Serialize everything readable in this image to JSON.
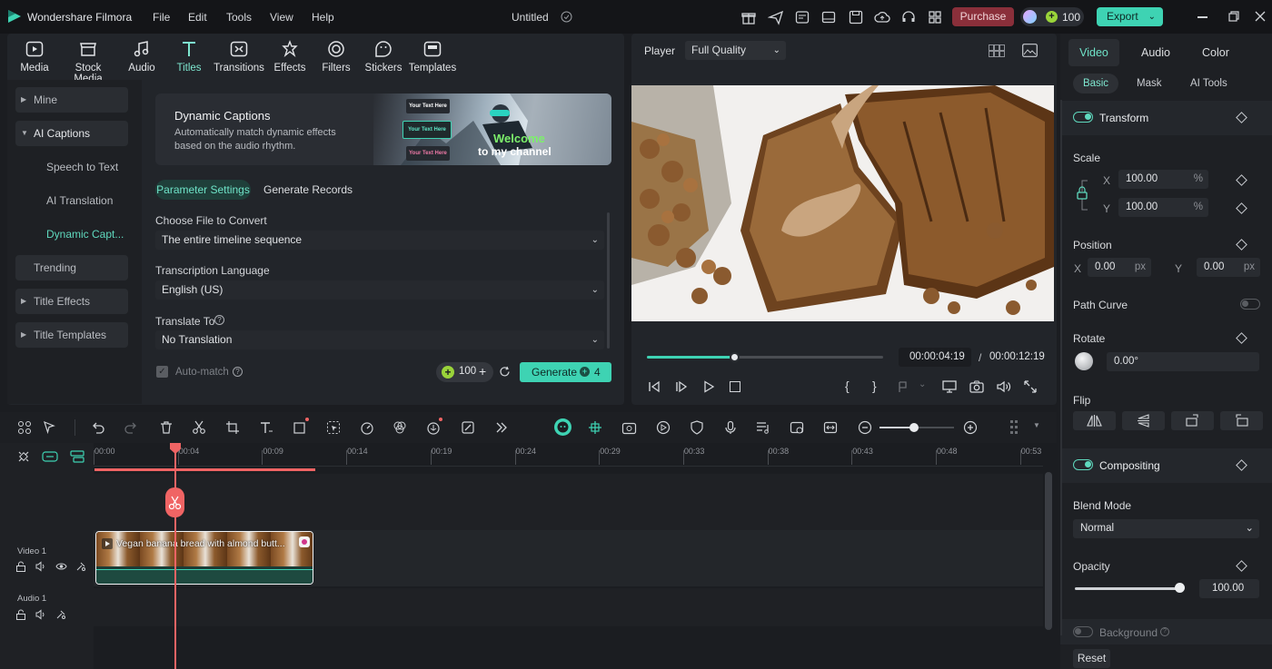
{
  "app": {
    "name": "Wondershare Filmora",
    "project_title": "Untitled"
  },
  "menu": [
    "File",
    "Edit",
    "Tools",
    "View",
    "Help"
  ],
  "topbar": {
    "purchase": "Purchase",
    "credits": "100",
    "export": "Export"
  },
  "library_tabs": [
    "Media",
    "Stock Media",
    "Audio",
    "Titles",
    "Transitions",
    "Effects",
    "Filters",
    "Stickers",
    "Templates"
  ],
  "active_library_tab": "Titles",
  "sidebar": {
    "mine": "Mine",
    "ai_captions": "AI Captions",
    "speech_to_text": "Speech to Text",
    "ai_translation": "AI Translation",
    "dynamic_captions": "Dynamic Capt...",
    "trending": "Trending",
    "title_effects": "Title Effects",
    "title_templates": "Title Templates"
  },
  "banner": {
    "title": "Dynamic Captions",
    "desc": "Automatically match dynamic effects based on the audio rhythm.",
    "card1": "Your Text Here",
    "card2": "Your Text Here",
    "card3": "Your Text Here",
    "overlay1": "Welcome",
    "overlay2": "to my channel"
  },
  "subtabs": {
    "param": "Parameter Settings",
    "records": "Generate Records"
  },
  "form": {
    "file_label": "Choose File to Convert",
    "file_value": "The entire timeline sequence",
    "lang_label": "Transcription Language",
    "lang_value": "English (US)",
    "translate_label": "Translate To",
    "translate_value": "No Translation",
    "automatch": "Auto-match",
    "credits": "100",
    "generate": "Generate",
    "generate_cost": "4"
  },
  "player": {
    "label": "Player",
    "quality": "Full Quality",
    "current_time": "00:00:04:19",
    "sep": "/",
    "total_time": "00:00:12:19",
    "progress": 0.37
  },
  "props": {
    "tabs": [
      "Video",
      "Audio",
      "Color"
    ],
    "subtabs": [
      "Basic",
      "Mask",
      "AI Tools"
    ],
    "transform": "Transform",
    "scale": "Scale",
    "x": "X",
    "y": "Y",
    "scale_x": "100.00",
    "scale_y": "100.00",
    "pct": "%",
    "position": "Position",
    "pos_x": "0.00",
    "pos_y": "0.00",
    "px": "px",
    "path_curve": "Path Curve",
    "rotate": "Rotate",
    "rotate_value": "0.00°",
    "flip": "Flip",
    "compositing": "Compositing",
    "blend_mode": "Blend Mode",
    "blend_value": "Normal",
    "opacity": "Opacity",
    "opacity_value": "100.00",
    "background": "Background",
    "reset": "Reset"
  },
  "timeline": {
    "ticks": [
      "00:00",
      "00:04",
      "00:09",
      "00:14",
      "00:19",
      "00:24",
      "00:29",
      "00:33",
      "00:38",
      "00:43",
      "00:48",
      "00:53"
    ],
    "video_track": "Video 1",
    "audio_track": "Audio 1",
    "clip_title": "Vegan banana bread with almond butt..."
  },
  "colors": {
    "accent": "#5fd9be",
    "purchase_bg": "#8a2f3a",
    "export_bg": "#3ed3b3",
    "playhead": "#f06464"
  }
}
